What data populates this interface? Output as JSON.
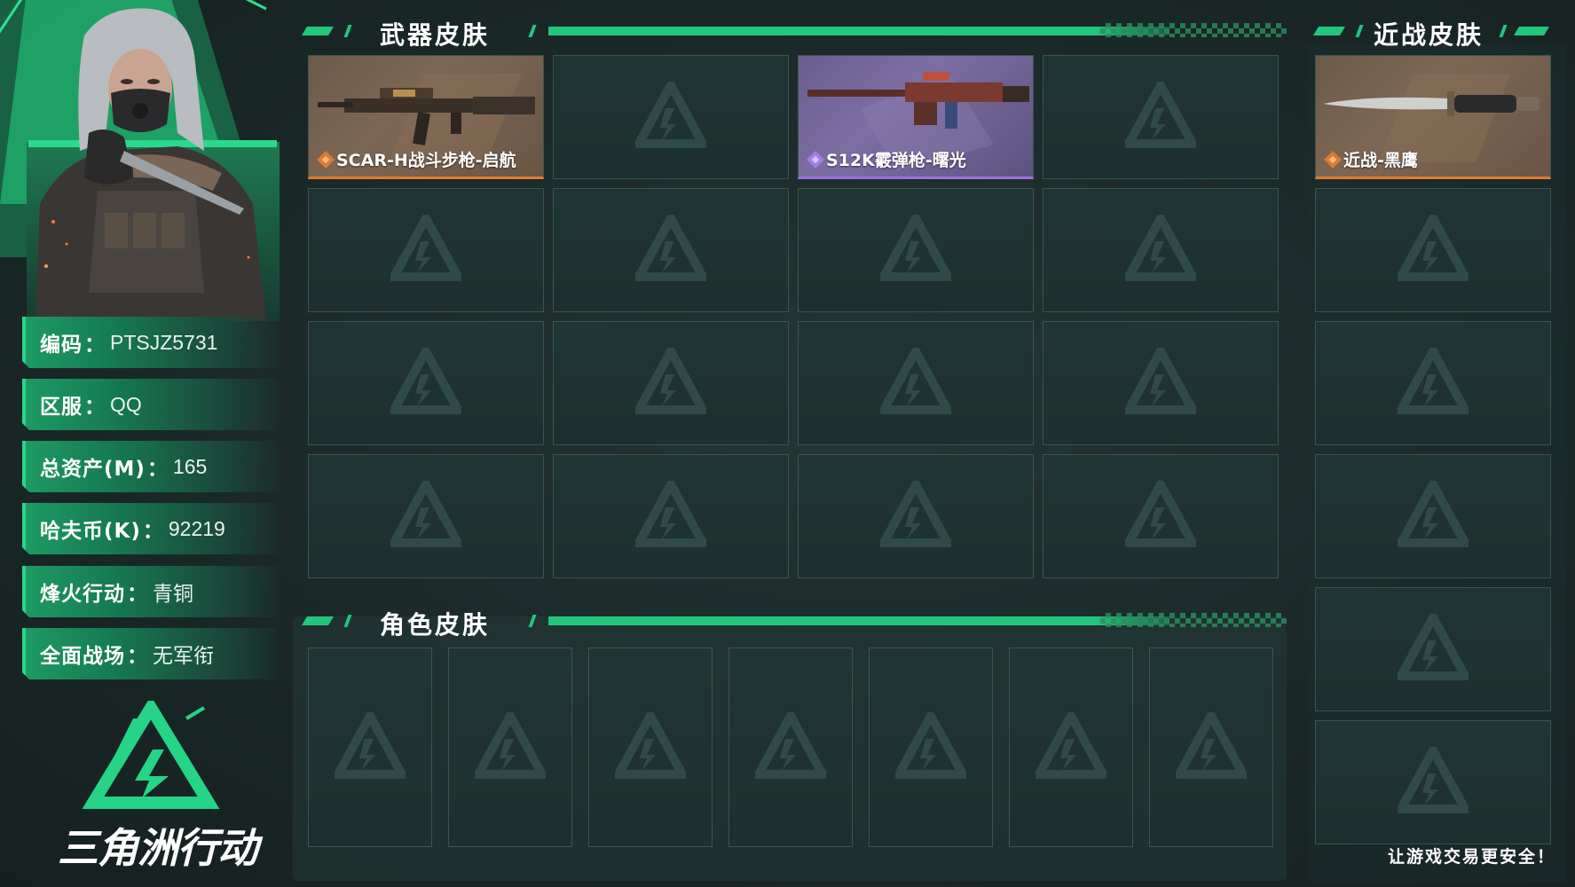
{
  "profile": {
    "fields": [
      {
        "label": "编码",
        "value": "PTSJZ5731"
      },
      {
        "label": "区服",
        "value": "QQ"
      },
      {
        "label": "总资产(M)",
        "value": "165"
      },
      {
        "label": "哈夫币(K)",
        "value": "92219"
      },
      {
        "label": "烽火行动",
        "value": "青铜"
      },
      {
        "label": "全面战场",
        "value": "无军衔"
      }
    ],
    "colon": "："
  },
  "brand": {
    "logo_text": "三角洲行动",
    "tagline": "让游戏交易更安全！"
  },
  "sections": {
    "weapon_skins": "武器皮肤",
    "melee_skins": "近战皮肤",
    "character_skins": "角色皮肤"
  },
  "weapon_slots": [
    {
      "name": "SCAR-H战斗步枪-启航",
      "rarity": "orange"
    },
    {
      "name": "",
      "rarity": "empty"
    },
    {
      "name": "S12K霰弹枪-曙光",
      "rarity": "purple"
    },
    {
      "name": "",
      "rarity": "empty"
    }
  ],
  "melee_slots": [
    {
      "name": "近战-黑鹰",
      "rarity": "orange"
    }
  ],
  "colors": {
    "accent_green": "#22c77e",
    "rarity_orange": "#e07a30",
    "rarity_purple": "#9b6ee0",
    "slot_bg": "#1f3534"
  }
}
